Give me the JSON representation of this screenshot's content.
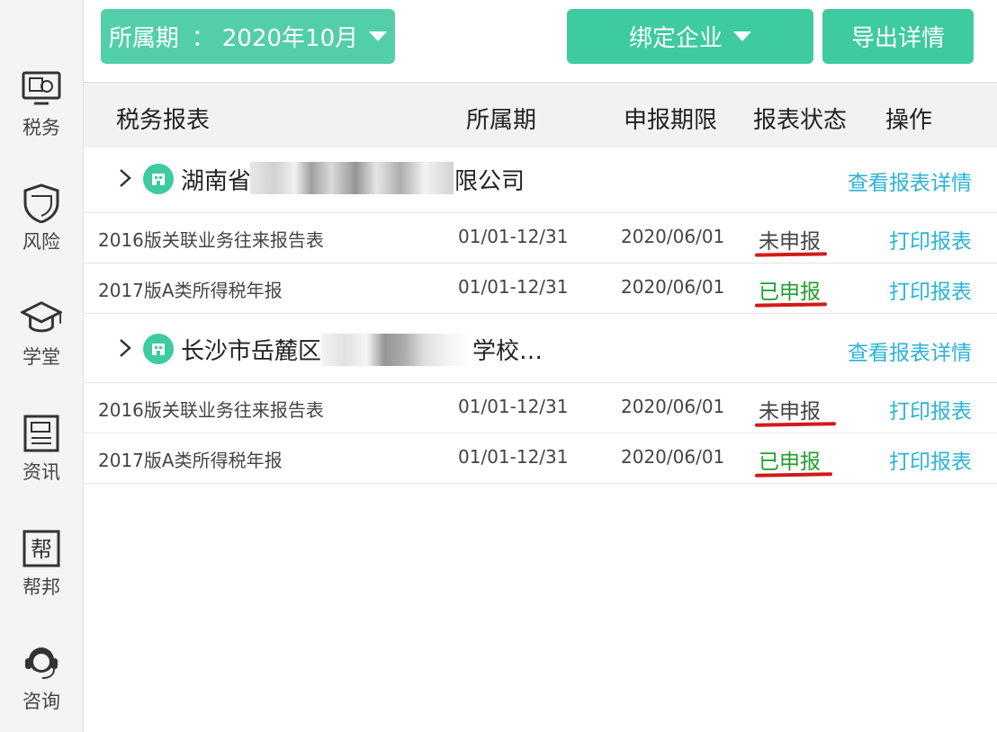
{
  "topbar": {
    "period_label": "所属期",
    "period_sep": "：",
    "period_value": "2020年10月",
    "bind_label": "绑定企业",
    "export_label": "导出详情"
  },
  "sidebar": {
    "items": [
      {
        "label": "税务",
        "icon": "monitor-tax-icon"
      },
      {
        "label": "风险",
        "icon": "shield-icon"
      },
      {
        "label": "学堂",
        "icon": "graduation-cap-icon"
      },
      {
        "label": "资讯",
        "icon": "news-icon"
      },
      {
        "label": "帮邦",
        "icon": "help-box-icon"
      },
      {
        "label": "咨询",
        "icon": "headset-icon"
      }
    ]
  },
  "table": {
    "headers": [
      "税务报表",
      "所属期",
      "申报期限",
      "报表状态",
      "操作"
    ]
  },
  "companies": [
    {
      "name_prefix": "湖南省",
      "name_suffix": "限公司",
      "detail_link": "查看报表详情",
      "reports": [
        {
          "name": "2016版关联业务往来报告表",
          "period": "01/01-12/31",
          "deadline": "2020/06/01",
          "status": "未申报",
          "action": "打印报表"
        },
        {
          "name": "2017版A类所得税年报",
          "period": "01/01-12/31",
          "deadline": "2020/06/01",
          "status": "已申报",
          "action": "打印报表"
        }
      ]
    },
    {
      "name_prefix": "长沙市岳麓区",
      "name_suffix": "学校…",
      "detail_link": "查看报表详情",
      "reports": [
        {
          "name": "2016版关联业务往来报告表",
          "period": "01/01-12/31",
          "deadline": "2020/06/01",
          "status": "未申报",
          "action": "打印报表"
        },
        {
          "name": "2017版A类所得税年报",
          "period": "01/01-12/31",
          "deadline": "2020/06/01",
          "status": "已申报",
          "action": "打印报表"
        }
      ]
    }
  ],
  "colors": {
    "accent": "#3ecb9f",
    "link": "#2ab3d6",
    "filed": "#1e9e2c",
    "annotation": "#d11a1a"
  }
}
